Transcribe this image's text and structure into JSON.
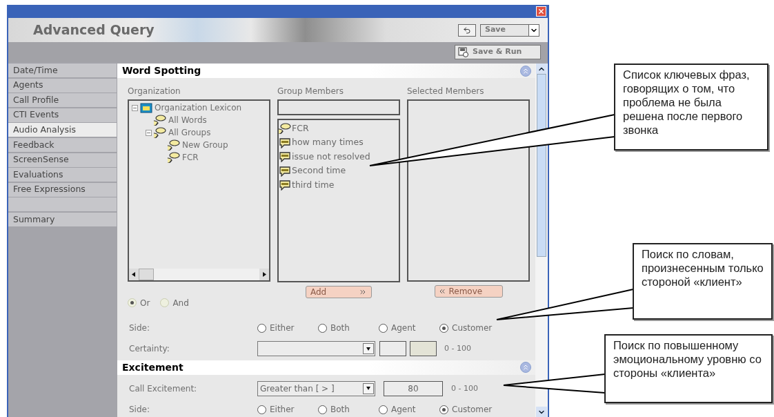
{
  "window": {
    "title": "Advanced Query",
    "save_select": "Save",
    "save_run": "Save & Run"
  },
  "sidebar": {
    "items": [
      {
        "kind": "item",
        "label": "Date/Time",
        "selected": false
      },
      {
        "kind": "item",
        "label": "Agents",
        "selected": false
      },
      {
        "kind": "item",
        "label": "Call Profile",
        "selected": false
      },
      {
        "kind": "item",
        "label": "CTI Events",
        "selected": false
      },
      {
        "kind": "item",
        "label": "Audio Analysis",
        "selected": true
      },
      {
        "kind": "item",
        "label": "Feedback",
        "selected": false
      },
      {
        "kind": "item",
        "label": "ScreenSense",
        "selected": false
      },
      {
        "kind": "item",
        "label": "Evaluations",
        "selected": false
      },
      {
        "kind": "item",
        "label": "Free Expressions",
        "selected": false
      },
      {
        "kind": "spacer"
      },
      {
        "kind": "item",
        "label": "Summary",
        "selected": false
      }
    ]
  },
  "word_spotting": {
    "title": "Word Spotting",
    "organization": {
      "label": "Organization",
      "tree": [
        {
          "label": "Organization Lexicon",
          "kind": "lexicon",
          "expanded": true,
          "children": [
            {
              "label": "All Words",
              "kind": "group"
            },
            {
              "label": "All Groups",
              "kind": "group",
              "expanded": true,
              "children": [
                {
                  "label": "New Group",
                  "kind": "group"
                },
                {
                  "label": "FCR",
                  "kind": "group"
                }
              ]
            }
          ]
        }
      ]
    },
    "group_members": {
      "label": "Group Members",
      "items": [
        {
          "label": "FCR",
          "kind": "group"
        },
        {
          "label": "how many times",
          "kind": "word"
        },
        {
          "label": "issue not resolved",
          "kind": "word"
        },
        {
          "label": "Second time",
          "kind": "word"
        },
        {
          "label": "third time",
          "kind": "word"
        }
      ]
    },
    "selected_members": {
      "label": "Selected Members"
    },
    "add_button": "Add",
    "remove_button": "Remove",
    "logic": [
      {
        "label": "Or",
        "selected": true
      },
      {
        "label": "And",
        "selected": false
      }
    ],
    "side": {
      "label": "Side:",
      "options": [
        {
          "label": "Either",
          "selected": false
        },
        {
          "label": "Both",
          "selected": false
        },
        {
          "label": "Agent",
          "selected": false
        },
        {
          "label": "Customer",
          "selected": true
        }
      ]
    },
    "certainty": {
      "label": "Certainty:",
      "range": "0 - 100"
    }
  },
  "excitement": {
    "title": "Excitement",
    "call_excitement": {
      "label": "Call Excitement:",
      "operator": "Greater than [ > ]",
      "value": "80",
      "range": "0 - 100"
    },
    "side": {
      "label": "Side:",
      "options": [
        {
          "label": "Either",
          "selected": false
        },
        {
          "label": "Both",
          "selected": false
        },
        {
          "label": "Agent",
          "selected": false
        },
        {
          "label": "Customer",
          "selected": true
        }
      ]
    }
  },
  "callouts": [
    {
      "text": "Список ключевых фраз, говорящих о том, что проблема не была решена после первого звонка"
    },
    {
      "text": "Поиск по словам, произнесенным только стороной «клиент»"
    },
    {
      "text": "Поиск по повышенному эмоциональному уровню со стороны «клиента»"
    }
  ]
}
